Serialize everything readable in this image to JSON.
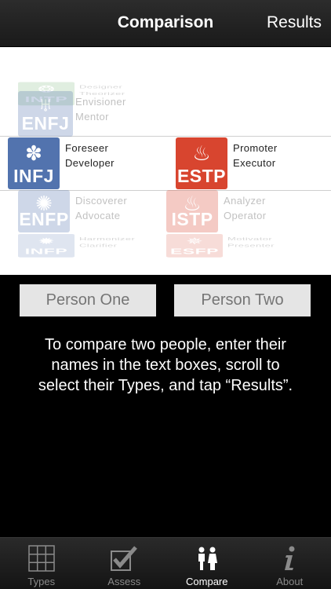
{
  "nav": {
    "title": "Comparison",
    "right_button": "Results"
  },
  "picker": {
    "left": {
      "above2": {
        "code": "INTP",
        "line1": "Designer",
        "line2": "Theorizer"
      },
      "above1": {
        "code": "ENFJ",
        "line1": "Envisioner",
        "line2": "Mentor"
      },
      "selected": {
        "code": "INFJ",
        "line1": "Foreseer",
        "line2": "Developer"
      },
      "below1": {
        "code": "ENFP",
        "line1": "Discoverer",
        "line2": "Advocate"
      },
      "below2": {
        "code": "INFP",
        "line1": "Harmonizer",
        "line2": "Clarifier"
      }
    },
    "right": {
      "selected": {
        "code": "ESTP",
        "line1": "Promoter",
        "line2": "Executor"
      },
      "below1": {
        "code": "ISTP",
        "line1": "Analyzer",
        "line2": "Operator"
      },
      "below2": {
        "code": "ESFP",
        "line1": "Motivator",
        "line2": "Presenter"
      }
    }
  },
  "inputs": {
    "person_one": "Person One",
    "person_two": "Person Two"
  },
  "instructions": "To compare two people, enter their names in the text boxes, scroll to select their Types, and tap “Results”.",
  "tabs": [
    {
      "label": "Types",
      "icon": "grid-icon"
    },
    {
      "label": "Assess",
      "icon": "checkbox-icon"
    },
    {
      "label": "Compare",
      "icon": "people-icon"
    },
    {
      "label": "About",
      "icon": "info-icon"
    }
  ],
  "active_tab": "Compare",
  "colors": {
    "blue_type": "#5273ae",
    "red_type": "#d8452f",
    "green_type": "#5aa55a"
  }
}
